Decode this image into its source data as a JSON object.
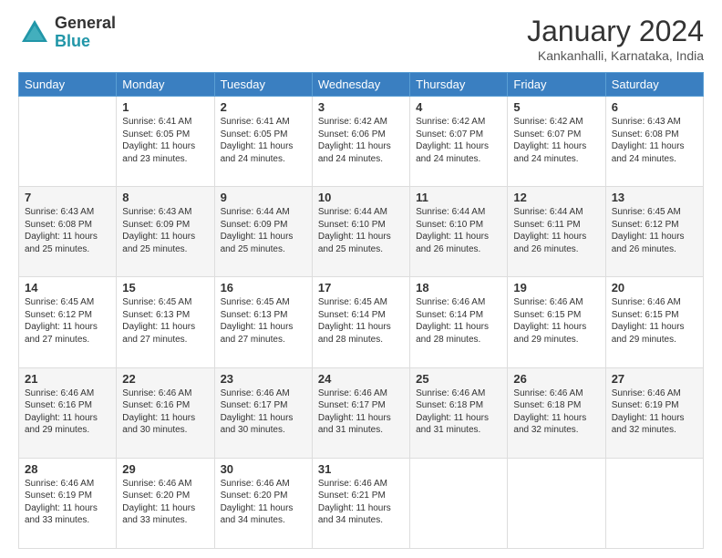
{
  "logo": {
    "general": "General",
    "blue": "Blue"
  },
  "title": "January 2024",
  "location": "Kankanhalli, Karnataka, India",
  "days": [
    "Sunday",
    "Monday",
    "Tuesday",
    "Wednesday",
    "Thursday",
    "Friday",
    "Saturday"
  ],
  "weeks": [
    [
      {
        "day": "",
        "sunrise": "",
        "sunset": "",
        "daylight": ""
      },
      {
        "day": "1",
        "sunrise": "Sunrise: 6:41 AM",
        "sunset": "Sunset: 6:05 PM",
        "daylight": "Daylight: 11 hours and 23 minutes."
      },
      {
        "day": "2",
        "sunrise": "Sunrise: 6:41 AM",
        "sunset": "Sunset: 6:05 PM",
        "daylight": "Daylight: 11 hours and 24 minutes."
      },
      {
        "day": "3",
        "sunrise": "Sunrise: 6:42 AM",
        "sunset": "Sunset: 6:06 PM",
        "daylight": "Daylight: 11 hours and 24 minutes."
      },
      {
        "day": "4",
        "sunrise": "Sunrise: 6:42 AM",
        "sunset": "Sunset: 6:07 PM",
        "daylight": "Daylight: 11 hours and 24 minutes."
      },
      {
        "day": "5",
        "sunrise": "Sunrise: 6:42 AM",
        "sunset": "Sunset: 6:07 PM",
        "daylight": "Daylight: 11 hours and 24 minutes."
      },
      {
        "day": "6",
        "sunrise": "Sunrise: 6:43 AM",
        "sunset": "Sunset: 6:08 PM",
        "daylight": "Daylight: 11 hours and 24 minutes."
      }
    ],
    [
      {
        "day": "7",
        "sunrise": "Sunrise: 6:43 AM",
        "sunset": "Sunset: 6:08 PM",
        "daylight": "Daylight: 11 hours and 25 minutes."
      },
      {
        "day": "8",
        "sunrise": "Sunrise: 6:43 AM",
        "sunset": "Sunset: 6:09 PM",
        "daylight": "Daylight: 11 hours and 25 minutes."
      },
      {
        "day": "9",
        "sunrise": "Sunrise: 6:44 AM",
        "sunset": "Sunset: 6:09 PM",
        "daylight": "Daylight: 11 hours and 25 minutes."
      },
      {
        "day": "10",
        "sunrise": "Sunrise: 6:44 AM",
        "sunset": "Sunset: 6:10 PM",
        "daylight": "Daylight: 11 hours and 25 minutes."
      },
      {
        "day": "11",
        "sunrise": "Sunrise: 6:44 AM",
        "sunset": "Sunset: 6:10 PM",
        "daylight": "Daylight: 11 hours and 26 minutes."
      },
      {
        "day": "12",
        "sunrise": "Sunrise: 6:44 AM",
        "sunset": "Sunset: 6:11 PM",
        "daylight": "Daylight: 11 hours and 26 minutes."
      },
      {
        "day": "13",
        "sunrise": "Sunrise: 6:45 AM",
        "sunset": "Sunset: 6:12 PM",
        "daylight": "Daylight: 11 hours and 26 minutes."
      }
    ],
    [
      {
        "day": "14",
        "sunrise": "Sunrise: 6:45 AM",
        "sunset": "Sunset: 6:12 PM",
        "daylight": "Daylight: 11 hours and 27 minutes."
      },
      {
        "day": "15",
        "sunrise": "Sunrise: 6:45 AM",
        "sunset": "Sunset: 6:13 PM",
        "daylight": "Daylight: 11 hours and 27 minutes."
      },
      {
        "day": "16",
        "sunrise": "Sunrise: 6:45 AM",
        "sunset": "Sunset: 6:13 PM",
        "daylight": "Daylight: 11 hours and 27 minutes."
      },
      {
        "day": "17",
        "sunrise": "Sunrise: 6:45 AM",
        "sunset": "Sunset: 6:14 PM",
        "daylight": "Daylight: 11 hours and 28 minutes."
      },
      {
        "day": "18",
        "sunrise": "Sunrise: 6:46 AM",
        "sunset": "Sunset: 6:14 PM",
        "daylight": "Daylight: 11 hours and 28 minutes."
      },
      {
        "day": "19",
        "sunrise": "Sunrise: 6:46 AM",
        "sunset": "Sunset: 6:15 PM",
        "daylight": "Daylight: 11 hours and 29 minutes."
      },
      {
        "day": "20",
        "sunrise": "Sunrise: 6:46 AM",
        "sunset": "Sunset: 6:15 PM",
        "daylight": "Daylight: 11 hours and 29 minutes."
      }
    ],
    [
      {
        "day": "21",
        "sunrise": "Sunrise: 6:46 AM",
        "sunset": "Sunset: 6:16 PM",
        "daylight": "Daylight: 11 hours and 29 minutes."
      },
      {
        "day": "22",
        "sunrise": "Sunrise: 6:46 AM",
        "sunset": "Sunset: 6:16 PM",
        "daylight": "Daylight: 11 hours and 30 minutes."
      },
      {
        "day": "23",
        "sunrise": "Sunrise: 6:46 AM",
        "sunset": "Sunset: 6:17 PM",
        "daylight": "Daylight: 11 hours and 30 minutes."
      },
      {
        "day": "24",
        "sunrise": "Sunrise: 6:46 AM",
        "sunset": "Sunset: 6:17 PM",
        "daylight": "Daylight: 11 hours and 31 minutes."
      },
      {
        "day": "25",
        "sunrise": "Sunrise: 6:46 AM",
        "sunset": "Sunset: 6:18 PM",
        "daylight": "Daylight: 11 hours and 31 minutes."
      },
      {
        "day": "26",
        "sunrise": "Sunrise: 6:46 AM",
        "sunset": "Sunset: 6:18 PM",
        "daylight": "Daylight: 11 hours and 32 minutes."
      },
      {
        "day": "27",
        "sunrise": "Sunrise: 6:46 AM",
        "sunset": "Sunset: 6:19 PM",
        "daylight": "Daylight: 11 hours and 32 minutes."
      }
    ],
    [
      {
        "day": "28",
        "sunrise": "Sunrise: 6:46 AM",
        "sunset": "Sunset: 6:19 PM",
        "daylight": "Daylight: 11 hours and 33 minutes."
      },
      {
        "day": "29",
        "sunrise": "Sunrise: 6:46 AM",
        "sunset": "Sunset: 6:20 PM",
        "daylight": "Daylight: 11 hours and 33 minutes."
      },
      {
        "day": "30",
        "sunrise": "Sunrise: 6:46 AM",
        "sunset": "Sunset: 6:20 PM",
        "daylight": "Daylight: 11 hours and 34 minutes."
      },
      {
        "day": "31",
        "sunrise": "Sunrise: 6:46 AM",
        "sunset": "Sunset: 6:21 PM",
        "daylight": "Daylight: 11 hours and 34 minutes."
      },
      {
        "day": "",
        "sunrise": "",
        "sunset": "",
        "daylight": ""
      },
      {
        "day": "",
        "sunrise": "",
        "sunset": "",
        "daylight": ""
      },
      {
        "day": "",
        "sunrise": "",
        "sunset": "",
        "daylight": ""
      }
    ]
  ]
}
